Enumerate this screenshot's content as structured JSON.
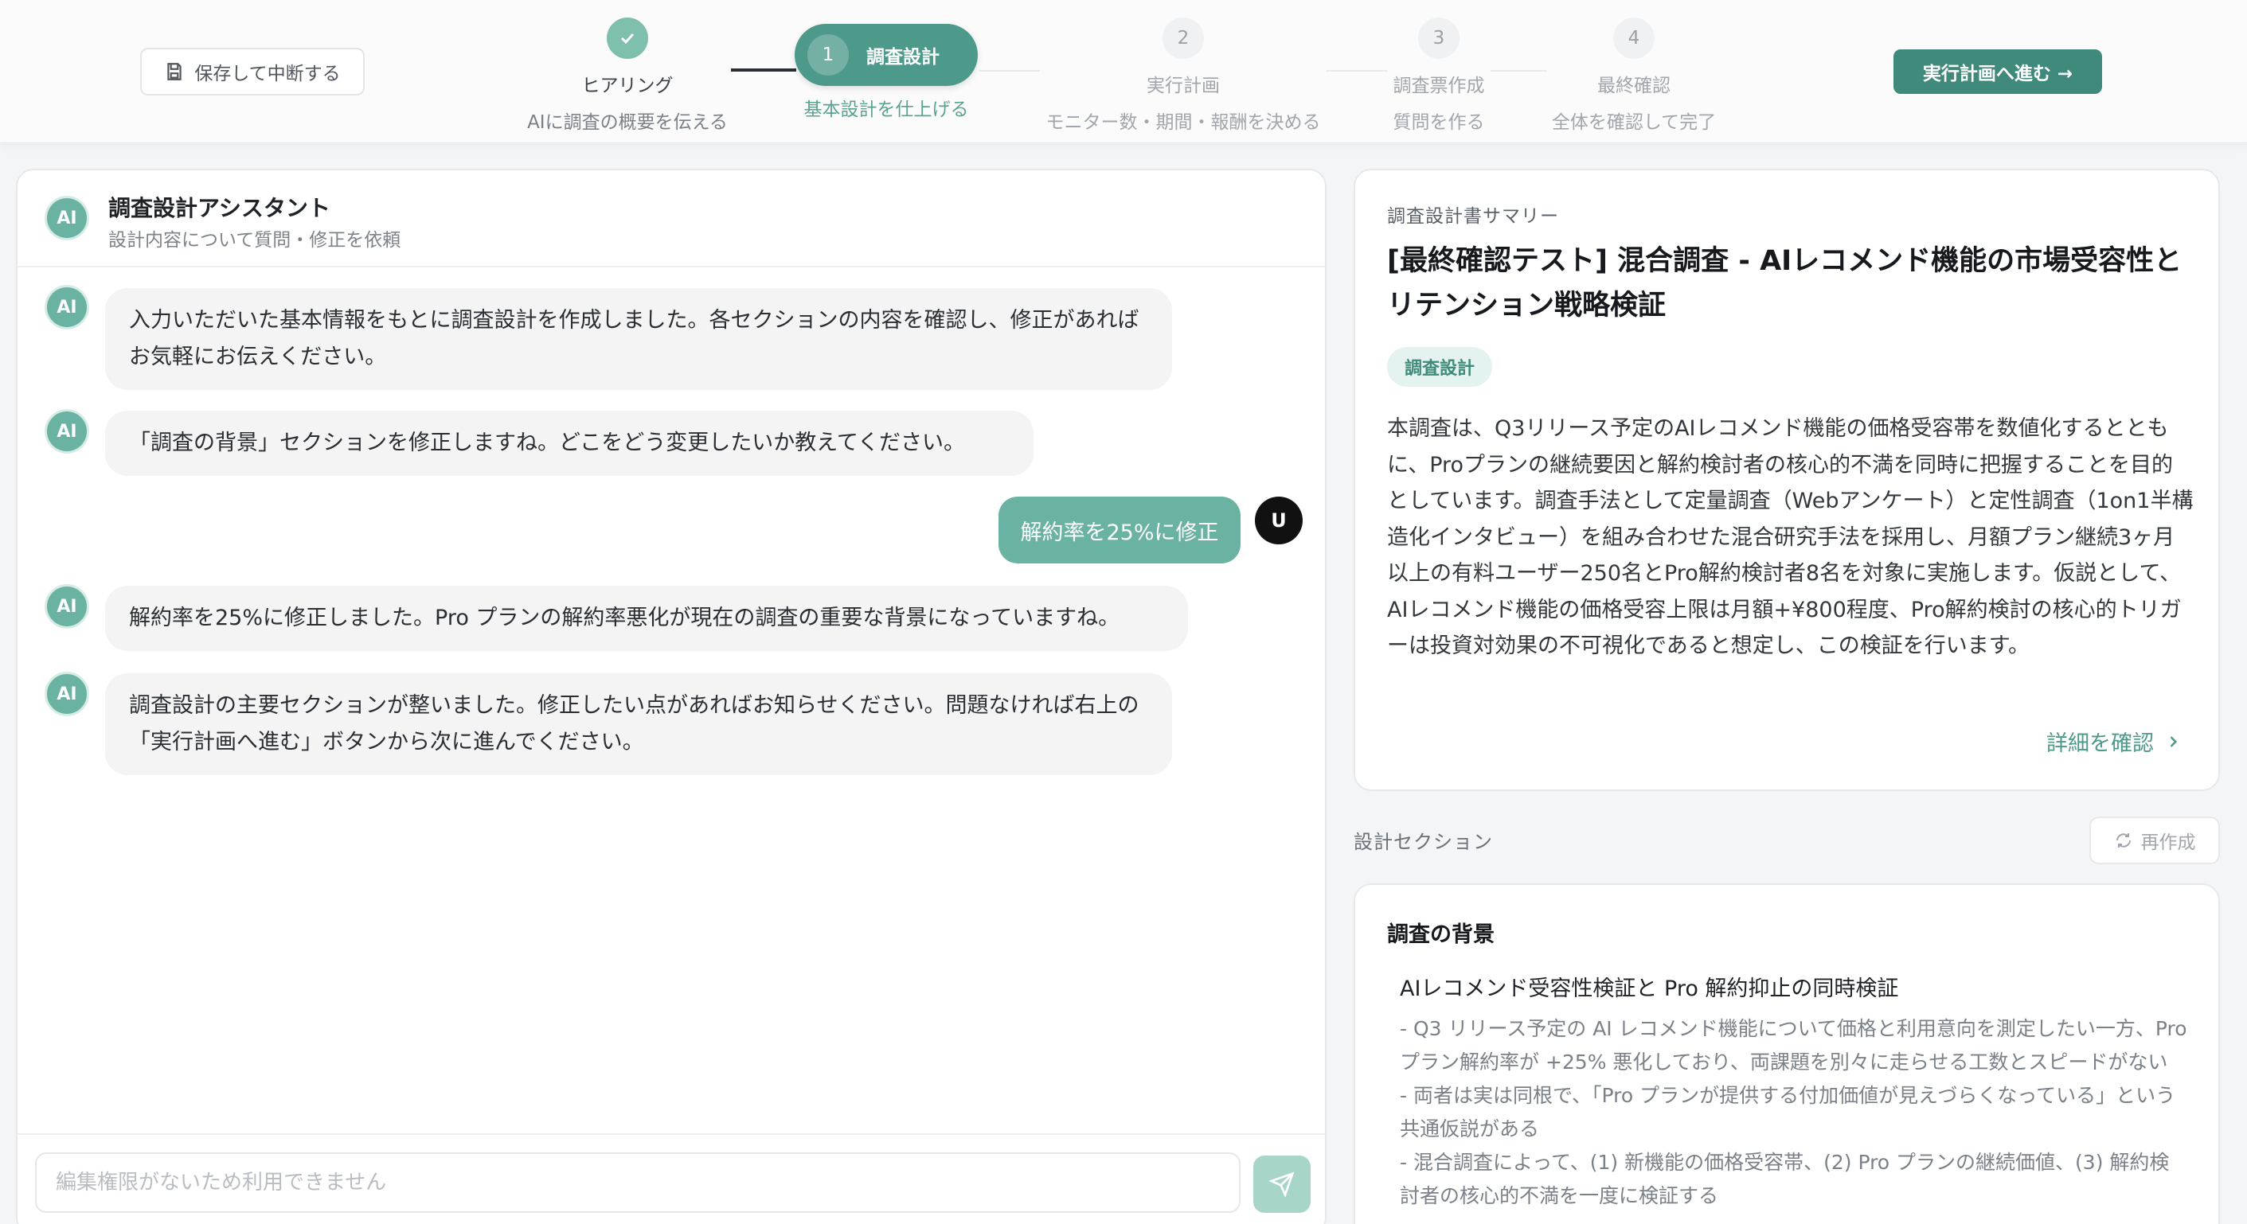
{
  "header": {
    "save_button": "保存して中断する",
    "steps": [
      {
        "title": "ヒアリング",
        "subtitle": "AIに調査の概要を伝える"
      },
      {
        "number": "1",
        "title": "調査設計",
        "subtitle": "基本設計を仕上げる"
      },
      {
        "number": "2",
        "title": "実行計画",
        "subtitle": "モニター数・期間・報酬を決める"
      },
      {
        "number": "3",
        "title": "調査票作成",
        "subtitle": "質問を作る"
      },
      {
        "number": "4",
        "title": "最終確認",
        "subtitle": "全体を確認して完了"
      }
    ],
    "next_button": "実行計画へ進む →"
  },
  "chat": {
    "title": "調査設計アシスタント",
    "subtitle": "設計内容について質問・修正を依頼",
    "ai_label": "AI",
    "user_label": "U",
    "messages": [
      {
        "role": "ai",
        "text": "入力いただいた基本情報をもとに調査設計を作成しました。各セクションの内容を確認し、修正があればお気軽にお伝えください。"
      },
      {
        "role": "ai",
        "text": "「調査の背景」セクションを修正しますね。どこをどう変更したいか教えてください。"
      },
      {
        "role": "user",
        "text": "解約率を25%に修正"
      },
      {
        "role": "ai",
        "text": "解約率を25%に修正しました。Pro プランの解約率悪化が現在の調査の重要な背景になっていますね。"
      },
      {
        "role": "ai",
        "text": "調査設計の主要セクションが整いました。修正したい点があればお知らせください。問題なければ右上の「実行計画へ進む」ボタンから次に進んでください。"
      }
    ],
    "input_placeholder": "編集権限がないため利用できません"
  },
  "summary": {
    "label": "調査設計書サマリー",
    "title": "[最終確認テスト] 混合調査 - AIレコメンド機能の市場受容性とリテンション戦略検証",
    "tag": "調査設計",
    "body": "本調査は、Q3リリース予定のAIレコメンド機能の価格受容帯を数値化するとともに、Proプランの継続要因と解約検討者の核心的不満を同時に把握することを目的としています。調査手法として定量調査（Webアンケート）と定性調査（1on1半構造化インタビュー）を組み合わせた混合研究手法を採用し、月額プラン継続3ヶ月以上の有料ユーザー250名とPro解約検討者8名を対象に実施します。仮説として、AIレコメンド機能の価格受容上限は月額+¥800程度、Pro解約検討の核心的トリガーは投資対効果の不可視化であると想定し、この検証を行います。",
    "detail_link": "詳細を確認"
  },
  "sections": {
    "label": "設計セクション",
    "regen_button": "再作成",
    "background": {
      "heading": "調査の背景",
      "subheading": "AIレコメンド受容性検証と Pro 解約抑止の同時検証",
      "bullets": [
        "- Q3 リリース予定の AI レコメンド機能について価格と利用意向を測定したい一方、Pro プラン解約率が +25% 悪化しており、両課題を別々に走らせる工数とスピードがない",
        "- 両者は実は同根で、「Pro プランが提供する付加価値が見えづらくなっている」という共通仮説がある",
        "- 混合調査によって、(1) 新機能の価格受容帯、(2) Pro プランの継続価値、(3) 解約検討者の核心的不満を一度に検証する"
      ]
    }
  },
  "colors": {
    "accent": "#4d9a8a",
    "accent_light": "#6ab3a2",
    "user_bubble": "#6ab3a2"
  }
}
